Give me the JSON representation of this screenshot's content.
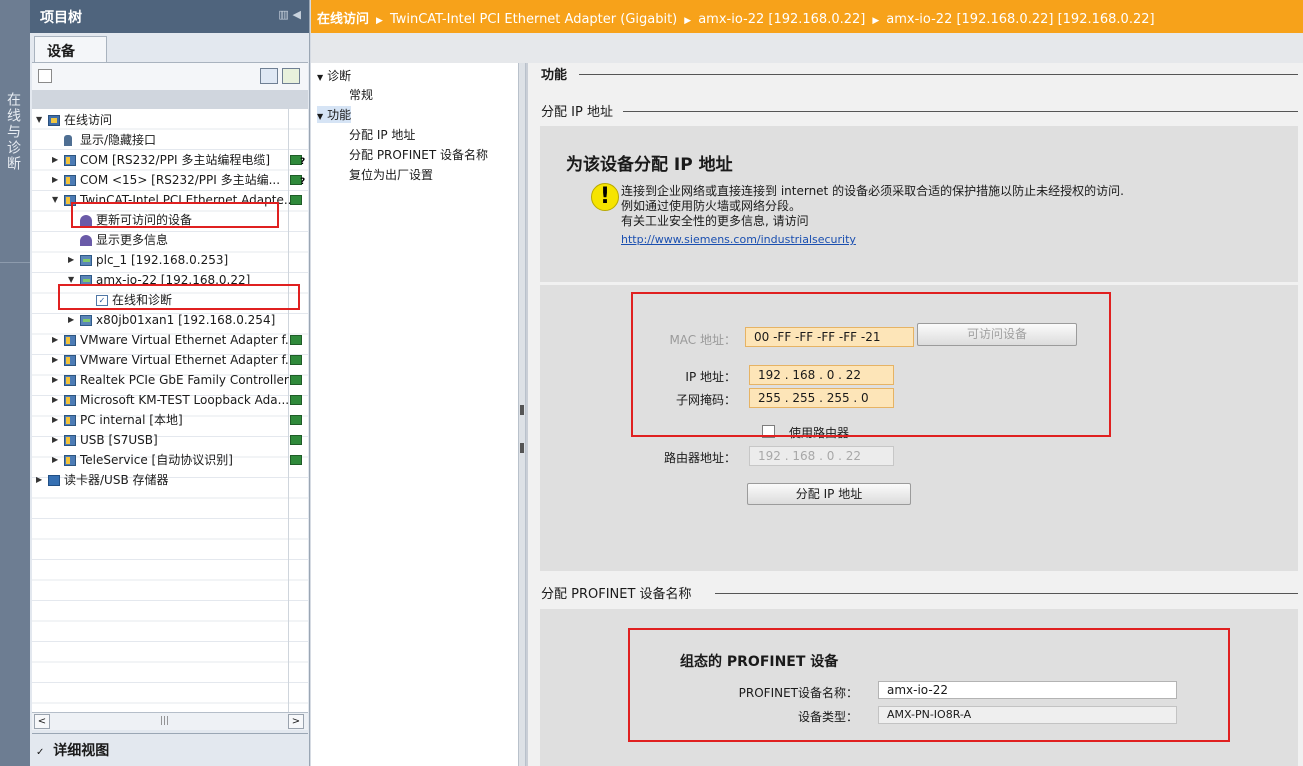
{
  "sidebar_vertical_label": "在线与诊断",
  "project_tree": {
    "title": "项目树",
    "tab_label": "设备",
    "items": [
      {
        "label": "在线访问",
        "level": 0,
        "expanded": true,
        "icon": "folder-online-icon"
      },
      {
        "label": "显示/隐藏接口",
        "level": 1,
        "icon": "key-icon"
      },
      {
        "label": "COM [RS232/PPI 多主站编程电缆]",
        "level": 1,
        "expanded": false,
        "icon": "interface-icon",
        "status": "question"
      },
      {
        "label": "COM <15> [RS232/PPI 多主站编...",
        "level": 1,
        "expanded": false,
        "icon": "interface-icon",
        "status": "question"
      },
      {
        "label": "TwinCAT-Intel PCI Ethernet Adapte...",
        "level": 1,
        "expanded": true,
        "icon": "interface-icon",
        "status": "ok"
      },
      {
        "label": "更新可访问的设备",
        "level": 2,
        "icon": "update-devices-icon"
      },
      {
        "label": "显示更多信息",
        "level": 2,
        "icon": "info-icon"
      },
      {
        "label": "plc_1 [192.168.0.253]",
        "level": 2,
        "expanded": false,
        "icon": "device-icon"
      },
      {
        "label": "amx-io-22 [192.168.0.22]",
        "level": 2,
        "expanded": true,
        "icon": "device-icon"
      },
      {
        "label": "在线和诊断",
        "level": 3,
        "icon": "diagnostics-icon"
      },
      {
        "label": "x80jb01xan1 [192.168.0.254]",
        "level": 2,
        "expanded": false,
        "icon": "device-icon"
      },
      {
        "label": "VMware Virtual Ethernet Adapter f...",
        "level": 1,
        "expanded": false,
        "icon": "interface-icon",
        "status": "ok"
      },
      {
        "label": "VMware Virtual Ethernet Adapter f...",
        "level": 1,
        "expanded": false,
        "icon": "interface-icon",
        "status": "ok"
      },
      {
        "label": "Realtek PCIe GbE Family Controller",
        "level": 1,
        "expanded": false,
        "icon": "interface-icon",
        "status": "ok"
      },
      {
        "label": "Microsoft KM-TEST Loopback Ada...",
        "level": 1,
        "expanded": false,
        "icon": "interface-icon",
        "status": "ok"
      },
      {
        "label": "PC internal [本地]",
        "level": 1,
        "expanded": false,
        "icon": "interface-icon",
        "status": "ok"
      },
      {
        "label": "USB [S7USB]",
        "level": 1,
        "expanded": false,
        "icon": "interface-icon",
        "status": "ok"
      },
      {
        "label": "TeleService [自动协议识别]",
        "level": 1,
        "expanded": false,
        "icon": "interface-icon",
        "status": "ok"
      },
      {
        "label": "读卡器/USB 存储器",
        "level": 0,
        "expanded": false,
        "icon": "card-reader-icon"
      }
    ],
    "detail_view_label": "详细视图"
  },
  "breadcrumb": [
    "在线访问",
    "TwinCAT-Intel PCI Ethernet Adapter (Gigabit)",
    "amx-io-22 [192.168.0.22]",
    "amx-io-22 [192.168.0.22] [192.168.0.22]"
  ],
  "nav": {
    "items": [
      {
        "label": "诊断",
        "type": "group",
        "expanded": true
      },
      {
        "label": "常规",
        "type": "child"
      },
      {
        "label": "功能",
        "type": "group",
        "expanded": true,
        "selected": true
      },
      {
        "label": "分配 IP 地址",
        "type": "child"
      },
      {
        "label": "分配 PROFINET 设备名称",
        "type": "child"
      },
      {
        "label": "复位为出厂设置",
        "type": "child"
      }
    ]
  },
  "main": {
    "section_title": "功能",
    "assign_ip": {
      "section_label": "分配 IP 地址",
      "heading": "为该设备分配 IP 地址",
      "warning_lines": [
        "连接到企业网络或直接连接到 internet 的设备必须采取合适的保护措施以防止未经授权的访问.",
        "例如通过使用防火墙或网络分段。",
        "有关工业安全性的更多信息, 请访问"
      ],
      "warning_link": "http://www.siemens.com/industrialsecurity",
      "mac_label": "MAC 地址：",
      "mac_value": "00 -FF -FF -FF -FF -21",
      "accessible_devices_button": "可访问设备",
      "ip_label": "IP 地址：",
      "ip_value": "192 . 168 . 0   . 22",
      "subnet_label": "子网掩码：",
      "subnet_value": "255 . 255 . 255 . 0",
      "use_router_label": "使用路由器",
      "use_router_checked": false,
      "router_label": "路由器地址：",
      "router_value": "192 . 168 . 0   . 22",
      "assign_button": "分配 IP 地址"
    },
    "assign_profinet": {
      "section_label": "分配 PROFINET 设备名称",
      "heading": "组态的 PROFINET 设备",
      "name_label": "PROFINET设备名称：",
      "name_value": "amx-io-22",
      "type_label": "设备类型：",
      "type_value": "AMX-PN-IO8R-A"
    }
  },
  "colors": {
    "breadcrumb_bg": "#f7a21a",
    "tree_header_bg": "#4f647d",
    "highlight_red": "#e02020",
    "field_bg": "#fde5b8"
  }
}
